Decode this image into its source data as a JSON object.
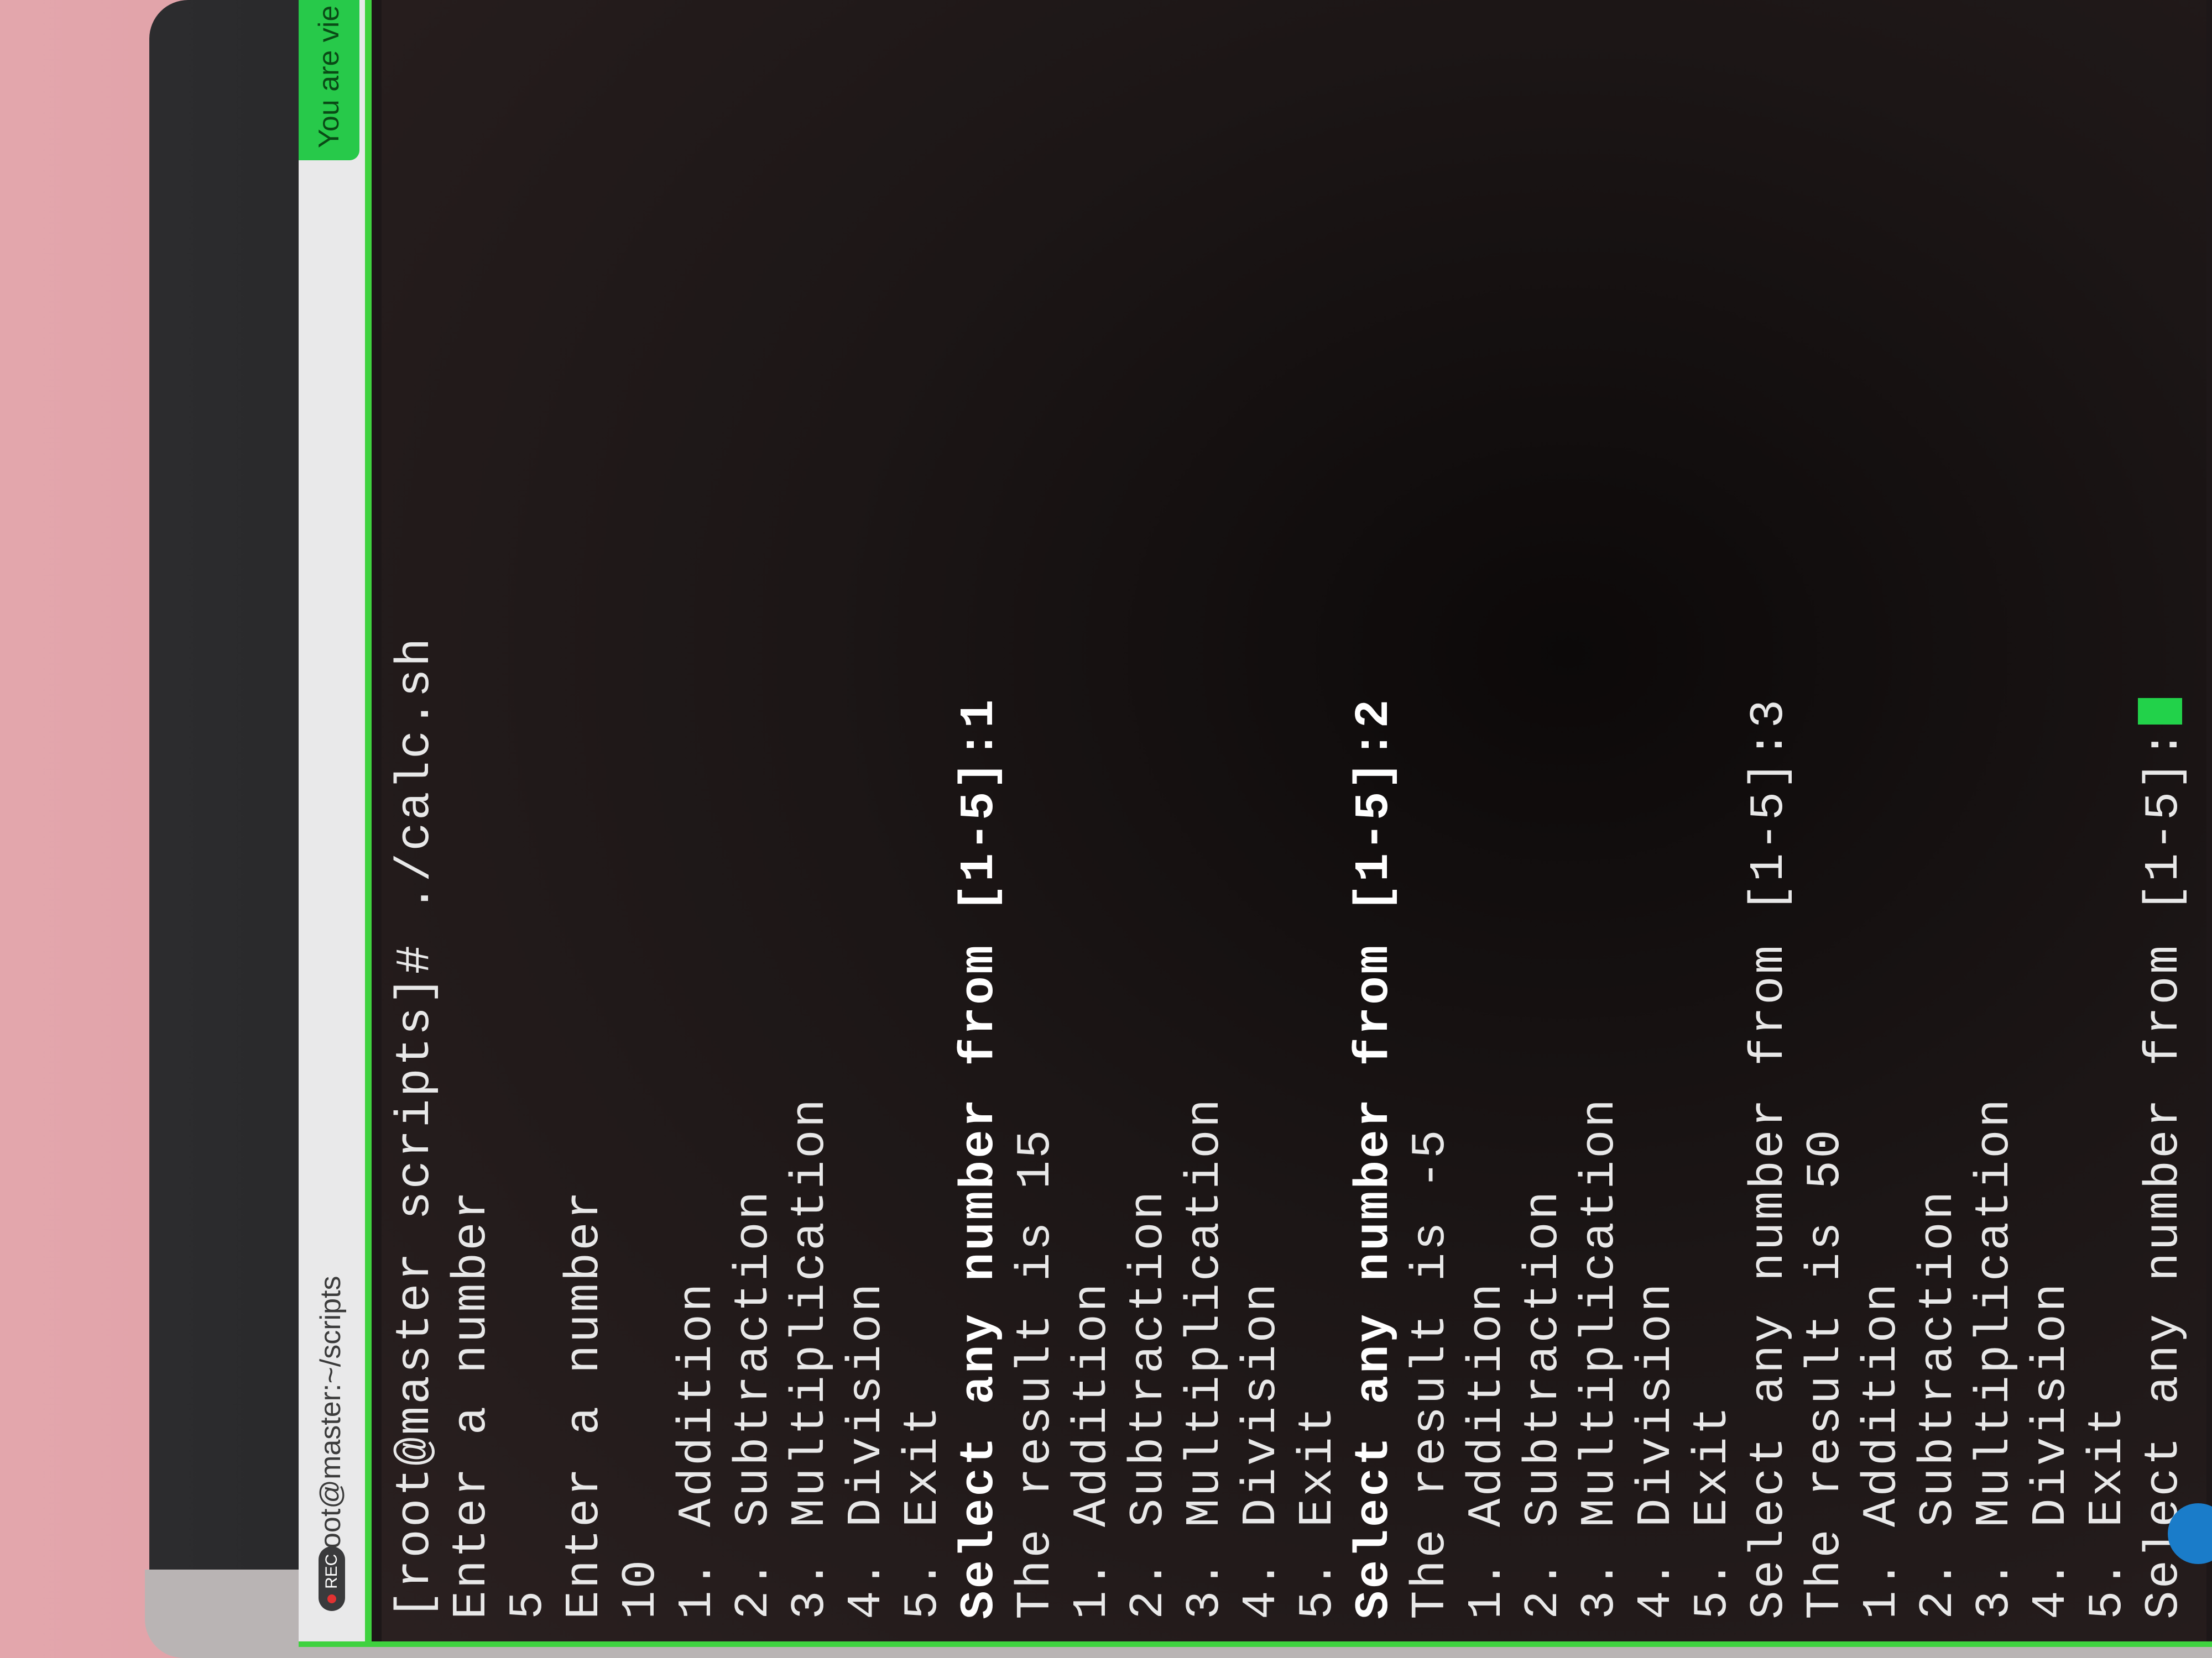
{
  "window": {
    "rec_label": "REC",
    "tab_title": "oot@master:~/scripts",
    "banner_text": "You are vie"
  },
  "terminal": {
    "lines": [
      {
        "text": "[root@master scripts]# ./calc.sh",
        "bold": false
      },
      {
        "text": "Enter a number",
        "bold": false
      },
      {
        "text": "5",
        "bold": false
      },
      {
        "text": "Enter a number",
        "bold": false
      },
      {
        "text": "10",
        "bold": false
      },
      {
        "text": "1. Addition",
        "bold": false
      },
      {
        "text": "2. Subtraction",
        "bold": false
      },
      {
        "text": "3. Multiplication",
        "bold": false
      },
      {
        "text": "4. Division",
        "bold": false
      },
      {
        "text": "5. Exit",
        "bold": false
      },
      {
        "text": "Select any number from [1-5]:1",
        "bold": true
      },
      {
        "text": "The result is 15",
        "bold": false
      },
      {
        "text": "1. Addition",
        "bold": false
      },
      {
        "text": "2. Subtraction",
        "bold": false
      },
      {
        "text": "3. Multiplication",
        "bold": false
      },
      {
        "text": "4. Division",
        "bold": false
      },
      {
        "text": "5. Exit",
        "bold": false
      },
      {
        "text": "Select any number from [1-5]:2",
        "bold": true
      },
      {
        "text": "The result is -5",
        "bold": false
      },
      {
        "text": "1. Addition",
        "bold": false
      },
      {
        "text": "2. Subtraction",
        "bold": false
      },
      {
        "text": "3. Multiplication",
        "bold": false
      },
      {
        "text": "4. Division",
        "bold": false
      },
      {
        "text": "5. Exit",
        "bold": false
      },
      {
        "text": "Select any number from [1-5]:3",
        "bold": false
      },
      {
        "text": "The result is 50",
        "bold": false
      },
      {
        "text": "1. Addition",
        "bold": false
      },
      {
        "text": "2. Subtraction",
        "bold": false
      },
      {
        "text": "3. Multiplication",
        "bold": false
      },
      {
        "text": "4. Division",
        "bold": false
      },
      {
        "text": "5. Exit",
        "bold": false
      },
      {
        "text": "Select any number from [1-5]:",
        "bold": false,
        "cursor": true
      }
    ]
  },
  "colors": {
    "accent": "#3fd23f",
    "cursor": "#22d24a",
    "terminal_bg": "#1d1718",
    "text": "#e8e8e8"
  }
}
